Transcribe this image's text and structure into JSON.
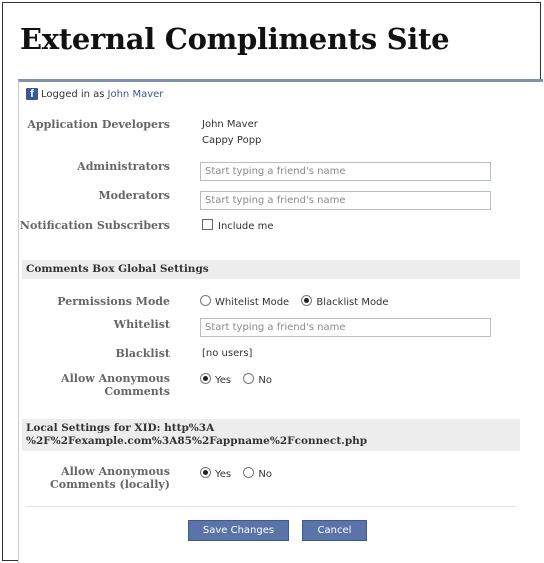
{
  "header": {
    "title": "External Compliments Site"
  },
  "login": {
    "prefix": "Logged in as",
    "user": "John Maver",
    "icon": "facebook-icon"
  },
  "app_settings": {
    "developers_label": "Application Developers",
    "developers": [
      "John Maver",
      "Cappy Popp"
    ],
    "administrators_label": "Administrators",
    "administrators_placeholder": "Start typing a friend's name",
    "moderators_label": "Moderators",
    "moderators_placeholder": "Start typing a friend's name",
    "subscribers_label": "Notification Subscribers",
    "subscribers_checkbox": "Include me"
  },
  "global": {
    "section_title": "Comments Box Global Settings",
    "permissions_label": "Permissions Mode",
    "permissions_options": [
      "Whitelist Mode",
      "Blacklist Mode"
    ],
    "permissions_selected": "Blacklist Mode",
    "whitelist_label": "Whitelist",
    "whitelist_placeholder": "Start typing a friend's name",
    "blacklist_label": "Blacklist",
    "blacklist_value": "[no users]",
    "anon_label_line1": "Allow Anonymous",
    "anon_label_line2": "Comments",
    "anon_options": [
      "Yes",
      "No"
    ],
    "anon_selected": "Yes"
  },
  "local": {
    "section_title_line1": "Local Settings for XID: http%3A",
    "section_title_line2": "%2F%2Fexample.com%3A85%2Fappname%2Fconnect.php",
    "anon_label_line1": "Allow Anonymous",
    "anon_label_line2": "Comments (locally)",
    "anon_options": [
      "Yes",
      "No"
    ],
    "anon_selected": "Yes"
  },
  "actions": {
    "save": "Save Changes",
    "cancel": "Cancel"
  },
  "colors": {
    "facebook_blue": "#3b5998",
    "button_bg": "#5b74a8",
    "section_bg": "#ededed"
  }
}
